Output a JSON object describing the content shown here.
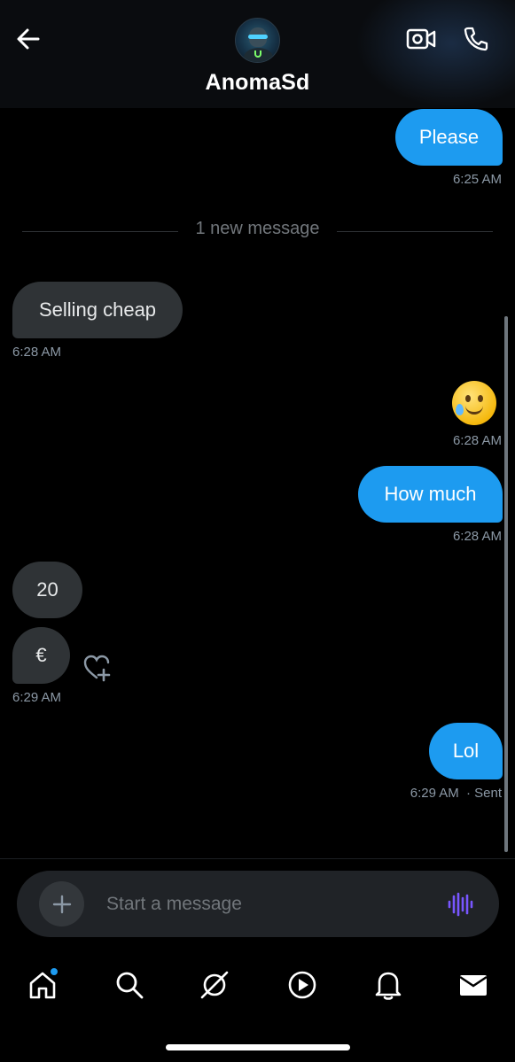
{
  "header": {
    "title": "AnomaSd",
    "back_icon": "arrow-left-icon",
    "video_icon": "video-call-icon",
    "phone_icon": "phone-call-icon"
  },
  "messages": [
    {
      "direction": "outgoing",
      "text": "Please",
      "time": "6:25 AM"
    },
    {
      "direction": "divider",
      "text": "1 new message"
    },
    {
      "direction": "incoming",
      "text": "Selling cheap",
      "time": "6:28 AM"
    },
    {
      "direction": "outgoing",
      "emoji": "face-holding-back-tears",
      "time": "6:28 AM"
    },
    {
      "direction": "outgoing",
      "text": "How much",
      "time": "6:28 AM"
    },
    {
      "direction": "incoming",
      "text": "20"
    },
    {
      "direction": "incoming",
      "text": "€",
      "time": "6:29 AM"
    },
    {
      "direction": "outgoing",
      "text": "Lol",
      "time": "6:29 AM",
      "status": "· Sent"
    }
  ],
  "composer": {
    "placeholder": "Start a message",
    "add_icon": "plus-icon",
    "voice_icon": "voice-waveform-icon"
  },
  "nav": {
    "items": [
      "home-icon",
      "search-icon",
      "grok-icon",
      "video-play-icon",
      "notifications-bell-icon",
      "messages-envelope-icon"
    ],
    "home_has_badge": true
  },
  "colors": {
    "accent": "#1d9bf0",
    "outgoing_bubble": "#1d9bf0",
    "incoming_bubble": "#2f3336",
    "background": "#000000",
    "voice_icon": "#7856ff"
  }
}
